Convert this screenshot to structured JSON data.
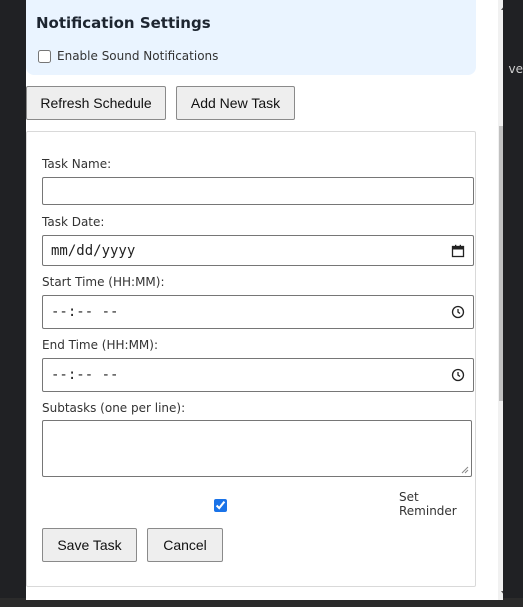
{
  "background": {
    "right_text": "ve"
  },
  "notifications": {
    "title": "Notification Settings",
    "sound_label": "Enable Sound Notifications",
    "sound_checked": false
  },
  "toolbar": {
    "refresh_label": "Refresh Schedule",
    "add_label": "Add New Task"
  },
  "form": {
    "task_name_label": "Task Name:",
    "task_name_value": "",
    "task_date_label": "Task Date:",
    "task_date_placeholder": "mm/dd/yyyy",
    "start_time_label": "Start Time (HH:MM):",
    "start_time_placeholder": "--:-- --",
    "end_time_label": "End Time (HH:MM):",
    "end_time_placeholder": "--:-- --",
    "subtasks_label": "Subtasks (one per line):",
    "subtasks_value": "",
    "reminder_label": "Set Reminder",
    "reminder_checked": true,
    "save_label": "Save Task",
    "cancel_label": "Cancel"
  },
  "icons": {
    "calendar": "calendar-icon",
    "clock": "clock-icon"
  }
}
